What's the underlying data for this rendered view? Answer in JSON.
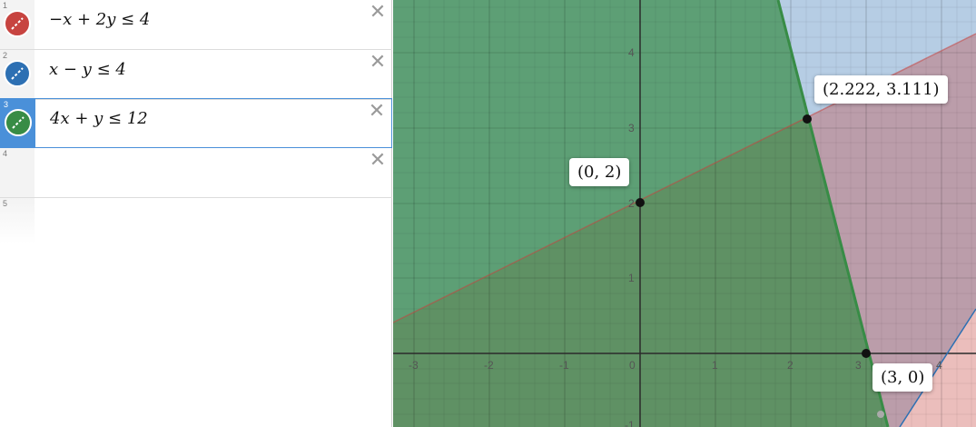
{
  "expressions": [
    {
      "index": "1",
      "latex": "−x + 2y ≤ 4",
      "color": "#c74440"
    },
    {
      "index": "2",
      "latex": "x − y ≤ 4",
      "color": "#2d70b3"
    },
    {
      "index": "3",
      "latex": "4x + y ≤ 12",
      "color": "#388c46"
    },
    {
      "index": "4",
      "latex": "",
      "color": ""
    },
    {
      "index": "5",
      "latex": "",
      "color": ""
    }
  ],
  "delete_icon": "close-icon",
  "axes": {
    "x_ticks": [
      "-3",
      "-2",
      "-1",
      "0",
      "1",
      "2",
      "3",
      "4"
    ],
    "y_ticks": [
      "4",
      "3",
      "2",
      "1",
      "-1"
    ]
  },
  "points": [
    {
      "x": 0,
      "y": 2,
      "label": "(0, 2)"
    },
    {
      "x": 2.222,
      "y": 3.111,
      "label": "(2.222, 3.111)"
    },
    {
      "x": 3,
      "y": 0,
      "label": "(3, 0)"
    }
  ]
}
